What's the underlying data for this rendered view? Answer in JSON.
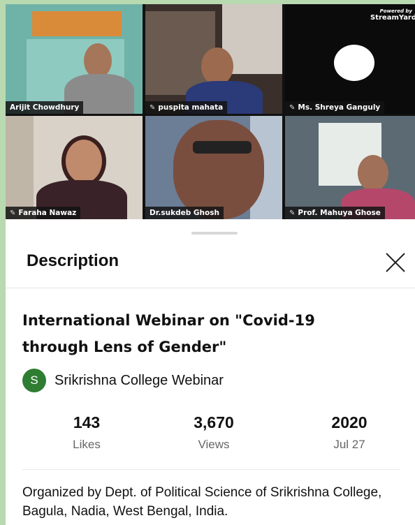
{
  "participants": [
    {
      "name": "Arijit Chowdhury",
      "muted": false
    },
    {
      "name": "puspita mahata",
      "muted": true
    },
    {
      "name": "Ms. Shreya Ganguly",
      "muted": true
    },
    {
      "name": "Faraha Nawaz",
      "muted": true
    },
    {
      "name": "Dr.sukdeb Ghosh",
      "muted": false
    },
    {
      "name": "Prof. Mahuya Ghose",
      "muted": true
    }
  ],
  "branding": {
    "powered_by": "Powered by",
    "name": "StreamYard"
  },
  "sheet": {
    "title": "Description",
    "video_title": "International Webinar on \"Covid-19 through Lens of Gender\"",
    "channel": {
      "initial": "S",
      "name": "Srikrishna College Webinar",
      "avatar_color": "#2e7d32"
    },
    "stats": [
      {
        "value": "143",
        "label": "Likes"
      },
      {
        "value": "3,670",
        "label": "Views"
      },
      {
        "value": "2020",
        "label": "Jul 27"
      }
    ],
    "description": "Organized by Dept. of Political Science of Srikrishna College, Bagula, Nadia, West Bengal, India."
  },
  "icons": {
    "mic_muted": "mic-muted-icon",
    "close": "close-icon"
  }
}
